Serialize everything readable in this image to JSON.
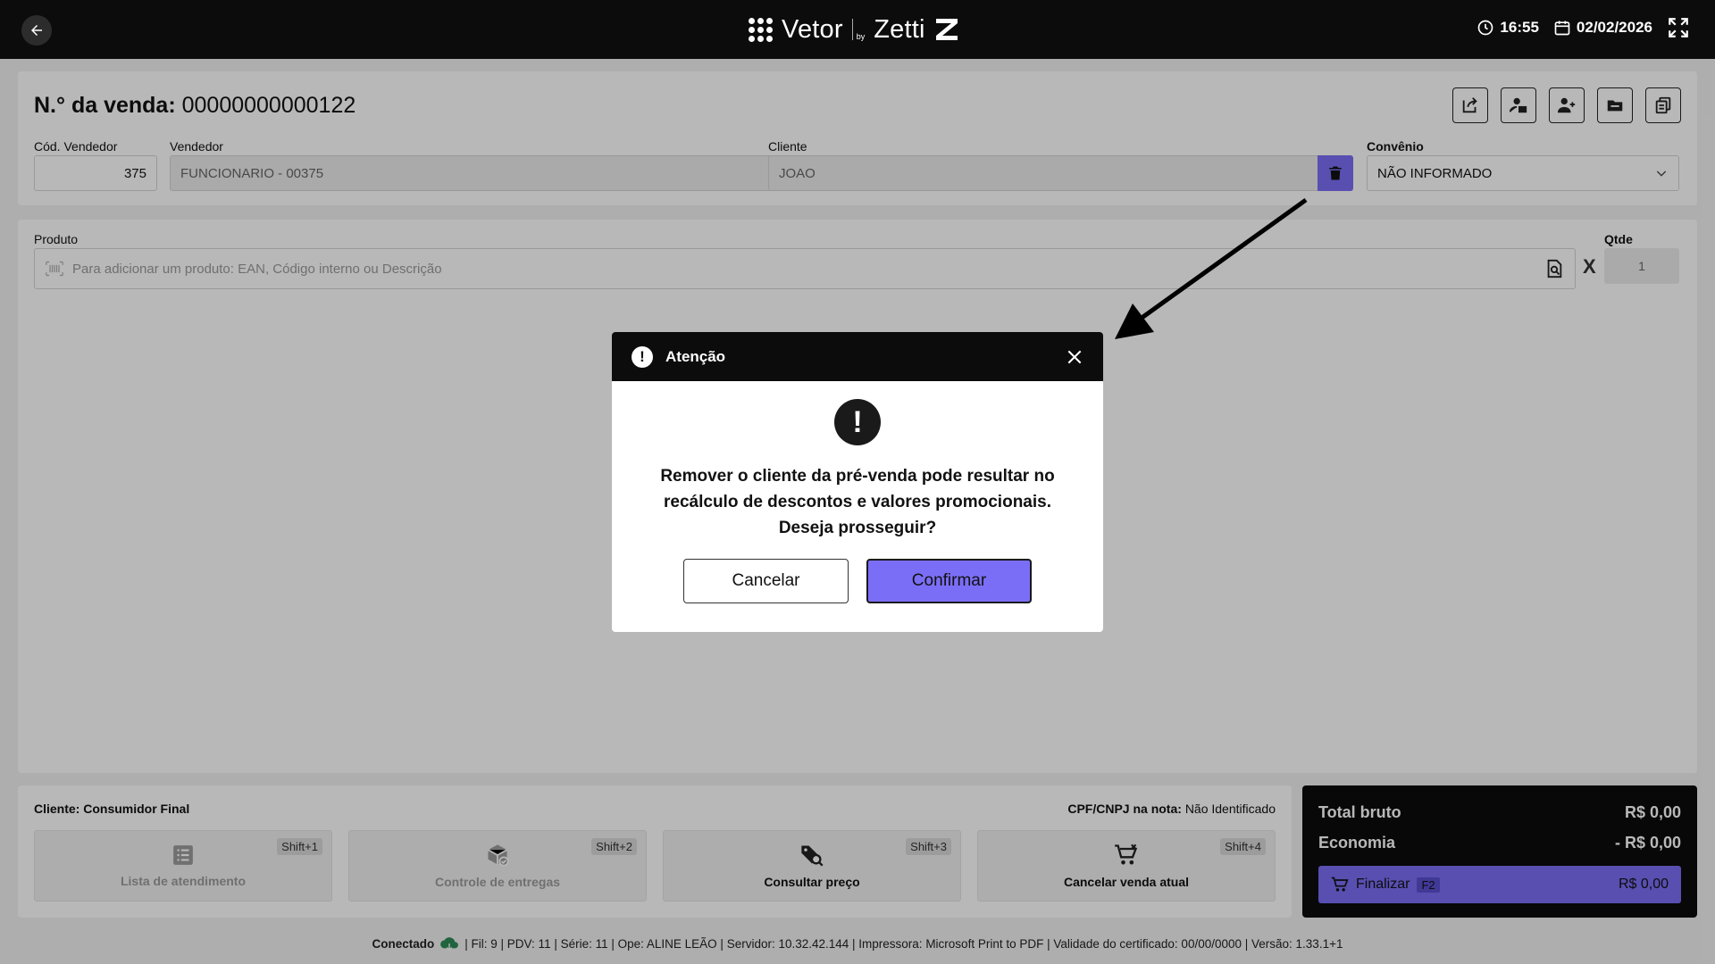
{
  "topbar": {
    "brand_main": "Vetor",
    "brand_by": "by",
    "brand_sub": "Zetti",
    "time": "16:55",
    "date": "02/02/2026"
  },
  "header": {
    "sale_label": "N.° da venda:",
    "sale_number": "00000000000122",
    "cod_vendedor_label": "Cód. Vendedor",
    "cod_vendedor_value": "375",
    "vendedor_label": "Vendedor",
    "vendedor_value": "FUNCIONARIO - 00375",
    "cliente_label": "Cliente",
    "cliente_value": "JOAO",
    "convenio_label": "Convênio",
    "convenio_value": "NÃO INFORMADO"
  },
  "product": {
    "label": "Produto",
    "placeholder": "Para adicionar um produto: EAN, Código interno ou Descrição",
    "times": "X",
    "qty_label": "Qtde",
    "qty_value": "1"
  },
  "footer": {
    "cliente_text": "Cliente: Consumidor Final",
    "cpf_label": "CPF/CNPJ na nota:",
    "cpf_value": "Não Identificado",
    "shortcuts": [
      {
        "label": "Lista de atendimento",
        "key": "Shift+1"
      },
      {
        "label": "Controle de entregas",
        "key": "Shift+2"
      },
      {
        "label": "Consultar preço",
        "key": "Shift+3"
      },
      {
        "label": "Cancelar venda atual",
        "key": "Shift+4"
      }
    ]
  },
  "totals": {
    "bruto_label": "Total bruto",
    "bruto_value": "R$ 0,00",
    "economia_label": "Economia",
    "economia_value": "- R$ 0,00",
    "finalizar_label": "Finalizar",
    "finalizar_key": "F2",
    "finalizar_amount": "R$  0,00"
  },
  "status": {
    "connected": "Conectado",
    "details": "| Fil: 9 | PDV: 11 | Série: 11 | Ope: ALINE LEÃO | Servidor: 10.32.42.144 | Impressora: Microsoft Print to PDF | Validade do certificado: 00/00/0000 | Versão: 1.33.1+1"
  },
  "modal": {
    "title": "Atenção",
    "message_line1": "Remover o cliente da pré-venda pode resultar no",
    "message_line2": "recálculo de descontos e valores promocionais.",
    "message_line3": "Deseja prosseguir?",
    "cancel_label": "Cancelar",
    "confirm_label": "Confirmar"
  },
  "colors": {
    "accent": "#7b6ef6",
    "dark": "#0c0c0c"
  }
}
